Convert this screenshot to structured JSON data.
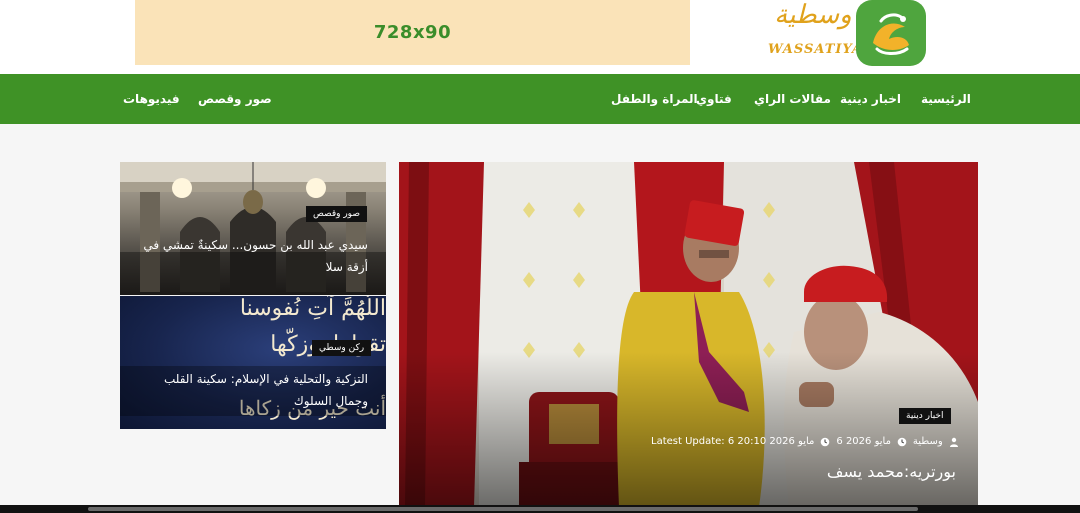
{
  "header": {
    "ad_label": "728x90",
    "logo_ar": "وسطية",
    "logo_en": "WASSATIYA",
    "brand_color": "#3f9226",
    "gold_color": "#e0a21c"
  },
  "nav": {
    "items": [
      {
        "label": "الرئيسية"
      },
      {
        "label": "اخبار دينية"
      },
      {
        "label": "مقالات الراي"
      },
      {
        "label": "فتاوي"
      },
      {
        "label": "المراة والطفل"
      },
      {
        "label": "صور وقصص"
      },
      {
        "label": "فيديوهات"
      }
    ]
  },
  "side_cards": [
    {
      "tag": "صور وقصص",
      "title": "سيدي عبد الله بن حسون... سكينةٌ تمشي في أزقة سلا"
    },
    {
      "tag": "ركن وسطي",
      "title": "التزكية والتحلية في الإسلام: سكينة القلب وجمال السلوك",
      "image_text_1": "اللَّهُمَّ آتِ نُفوسنا",
      "image_text_2": "تقواها، وزكّها",
      "image_text_3": "أنت خير من زكاها"
    }
  ],
  "hero": {
    "tag": "اخبار دينية",
    "author": "وسطية",
    "date": "6 مايو 2026",
    "updated": "Latest Update: 6 مايو 2026 20:10",
    "title": "بورتريه:محمد يسف"
  },
  "icons": {
    "author": "user-icon",
    "date": "clock-icon",
    "updated": "clock-icon"
  }
}
